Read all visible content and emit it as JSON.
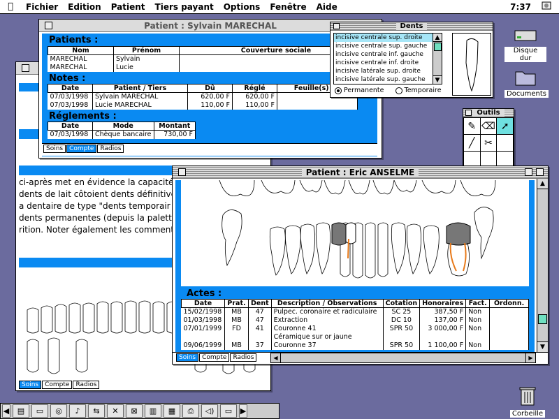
{
  "menubar": {
    "items": [
      "Fichier",
      "Edition",
      "Patient",
      "Tiers payant",
      "Options",
      "Fenêtre",
      "Aide"
    ],
    "clock": "7:37"
  },
  "desktop": {
    "disk_label": "Disque dur",
    "docs_label": "Documents",
    "trash_label": "Corbeille"
  },
  "back_window": {
    "text_lines": [
      "ci-après met en évidence la capacité",
      "dents de lait côtoient dents définitive",
      "a dentaire de type \"dents temporair",
      "dents permanentes (depuis la palett",
      "rition. Noter également les comment"
    ],
    "tabs": [
      "Soins",
      "Compte",
      "Radios"
    ]
  },
  "sylvain_window": {
    "title": "Patient : Sylvain MARECHAL",
    "patients_heading": "Patients :",
    "patients_columns": [
      "Nom",
      "Prénom",
      "Couverture sociale"
    ],
    "patients_rows": [
      [
        "MARECHAL",
        "Sylvain",
        ""
      ],
      [
        "MARECHAL",
        "Lucie",
        ""
      ]
    ],
    "notes_heading": "Notes :",
    "notes_columns": [
      "Date",
      "Patient / Tiers",
      "Dû",
      "Réglé",
      "Feuille(s) de"
    ],
    "notes_rows": [
      [
        "07/03/1998",
        "Sylvain MARECHAL",
        "620,00 F",
        "620,00 F",
        ""
      ],
      [
        "07/03/1998",
        "Lucie MARECHAL",
        "110,00 F",
        "110,00 F",
        ""
      ]
    ],
    "reglements_heading": "Réglements :",
    "reglements_columns": [
      "Date",
      "Mode",
      "Montant"
    ],
    "reglements_rows": [
      [
        "07/03/1998",
        "Chèque bancaire",
        "730,00 F"
      ]
    ],
    "tabs": [
      "Soins",
      "Compte",
      "Radios"
    ]
  },
  "dents_palette": {
    "title": "Dents",
    "items": [
      "incisive centrale sup. droite",
      "incisive centrale sup. gauche",
      "incisive centrale inf. gauche",
      "incisive centrale inf. droite",
      "incisive latérale sup. droite",
      "incisive latérale sup. gauche"
    ],
    "radio_permanent": "Permanente",
    "radio_temporary": "Temporaire"
  },
  "outils_palette": {
    "title": "Outils"
  },
  "eric_window": {
    "title": "Patient : Eric ANSELME",
    "actes_heading": "Actes :",
    "columns": [
      "Date",
      "Prat.",
      "Dent",
      "Description / Observations",
      "Cotation",
      "Honoraires",
      "Fact.",
      "Ordonn."
    ],
    "rows": [
      [
        "15/02/1998",
        "MB",
        "47",
        "Pulpec. coronaire et radiculaire",
        "SC 25",
        "387,50 F",
        "Non",
        ""
      ],
      [
        "01/03/1998",
        "MB",
        "47",
        "Extraction",
        "DC 10",
        "137,00 F",
        "Non",
        ""
      ],
      [
        "07/01/1999",
        "FD",
        "41",
        "Couronne 41",
        "SPR 50",
        "3 000,00 F",
        "Non",
        ""
      ],
      [
        "",
        "",
        "",
        "Céramique sur or jaune",
        "",
        "",
        "",
        ""
      ],
      [
        "09/06/1999",
        "MB",
        "37",
        "Couronne 37",
        "SPR 50",
        "1 100,00 F",
        "Non",
        ""
      ]
    ],
    "tabs": [
      "Soins",
      "Compte",
      "Radios"
    ]
  }
}
